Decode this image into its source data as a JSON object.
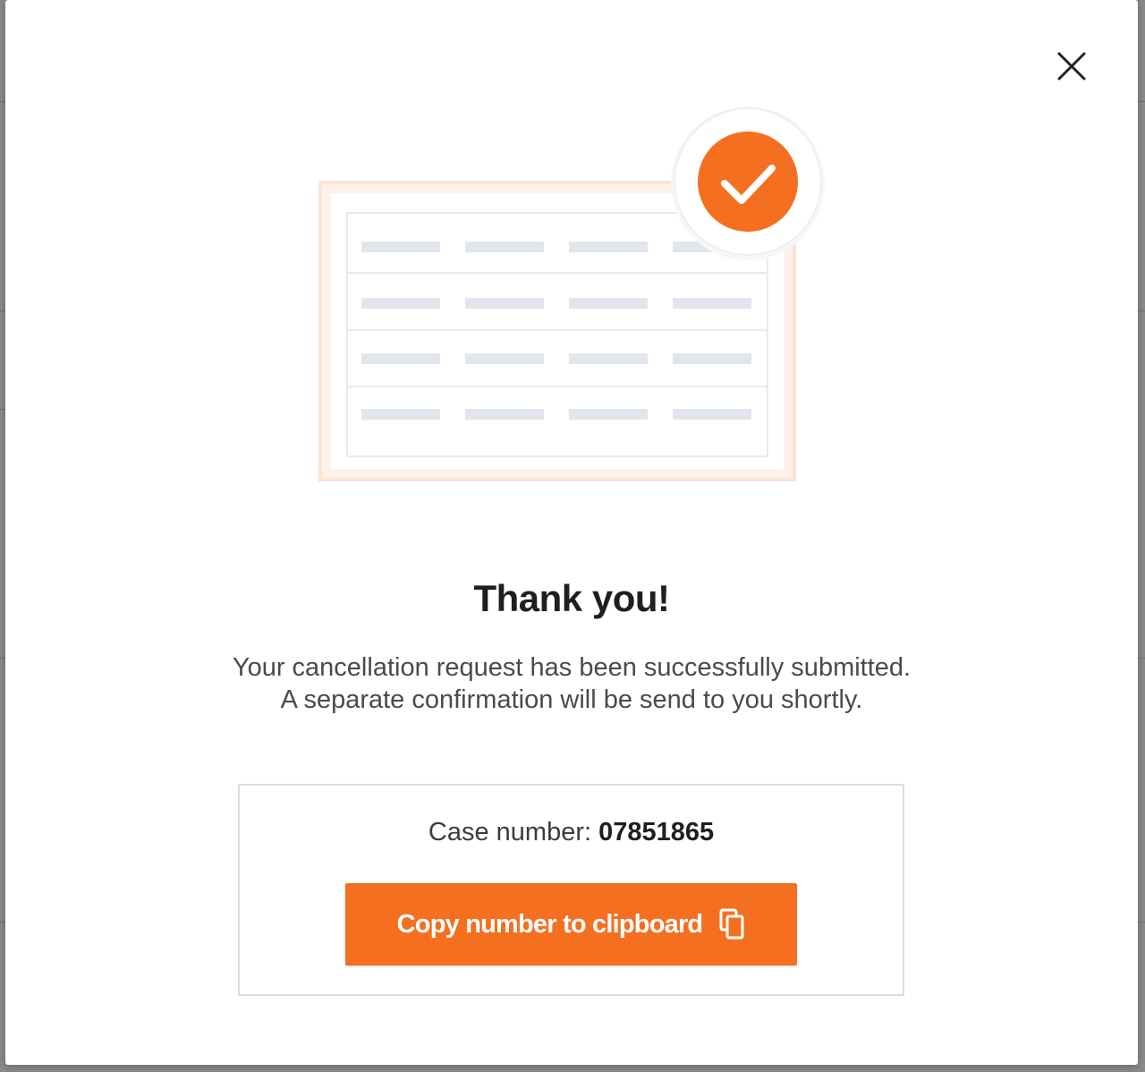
{
  "modal": {
    "close_icon": "close-icon",
    "illustration_icon": "table-with-checkmark-illustration",
    "accent_color": "#f47020",
    "title": "Thank you!",
    "message_line1": "Your cancellation request has been successfully submitted.",
    "message_line2": "A separate confirmation will be send to you shortly.",
    "case": {
      "label": "Case number:",
      "number": "07851865"
    },
    "copy_button": {
      "label": "Copy number to clipboard",
      "icon": "copy-icon"
    }
  }
}
